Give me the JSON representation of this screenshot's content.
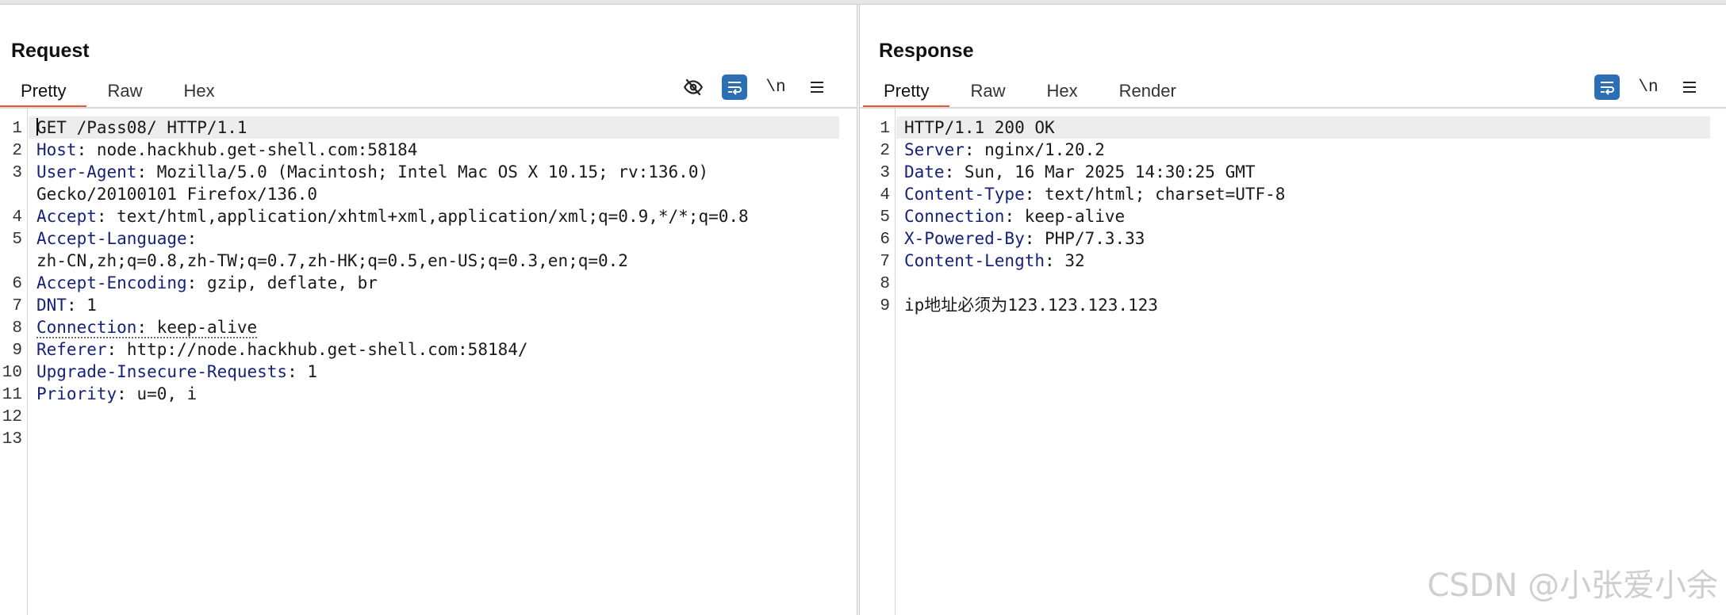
{
  "layout_switch": {
    "options": [
      "side-by-side",
      "stacked",
      "single"
    ]
  },
  "request": {
    "title": "Request",
    "tabs": [
      "Pretty",
      "Raw",
      "Hex"
    ],
    "active_tab": "Pretty",
    "tools": {
      "hide_icon": "eye-slash-icon",
      "wrap_icon": "wrap-text-icon",
      "newline_label": "\\n",
      "menu_icon": "menu-icon"
    },
    "line_numbers": [
      "1",
      "2",
      "3",
      "4",
      "5",
      "6",
      "7",
      "8",
      "9",
      "10",
      "11",
      "12",
      "13"
    ],
    "lines": [
      {
        "name": "",
        "sep": "",
        "value": "GET /Pass08/ HTTP/1.1"
      },
      {
        "name": "Host",
        "sep": ": ",
        "value": "node.hackhub.get-shell.com:58184"
      },
      {
        "name": "User-Agent",
        "sep": ": ",
        "value": "Mozilla/5.0 (Macintosh; Intel Mac OS X 10.15; rv:136.0)"
      },
      {
        "name": "",
        "sep": "",
        "value": "Gecko/20100101 Firefox/136.0"
      },
      {
        "name": "Accept",
        "sep": ": ",
        "value": "text/html,application/xhtml+xml,application/xml;q=0.9,*/*;q=0.8"
      },
      {
        "name": "Accept-Language",
        "sep": ":",
        "value": ""
      },
      {
        "name": "",
        "sep": "",
        "value": "zh-CN,zh;q=0.8,zh-TW;q=0.7,zh-HK;q=0.5,en-US;q=0.3,en;q=0.2"
      },
      {
        "name": "Accept-Encoding",
        "sep": ": ",
        "value": "gzip, deflate, br"
      },
      {
        "name": "DNT",
        "sep": ": ",
        "value": "1"
      },
      {
        "name": "Connection",
        "sep": ": ",
        "value": "keep-alive"
      },
      {
        "name": "Referer",
        "sep": ": ",
        "value": "http://node.hackhub.get-shell.com:58184/"
      },
      {
        "name": "Upgrade-Insecure-Requests",
        "sep": ": ",
        "value": "1"
      },
      {
        "name": "Priority",
        "sep": ": ",
        "value": "u=0, i"
      }
    ]
  },
  "response": {
    "title": "Response",
    "tabs": [
      "Pretty",
      "Raw",
      "Hex",
      "Render"
    ],
    "active_tab": "Pretty",
    "tools": {
      "wrap_icon": "wrap-text-icon",
      "newline_label": "\\n",
      "menu_icon": "menu-icon"
    },
    "line_numbers": [
      "1",
      "2",
      "3",
      "4",
      "5",
      "6",
      "7",
      "8",
      "9"
    ],
    "lines": [
      {
        "name": "",
        "sep": "",
        "value": "HTTP/1.1 200 OK"
      },
      {
        "name": "Server",
        "sep": ": ",
        "value": "nginx/1.20.2"
      },
      {
        "name": "Date",
        "sep": ": ",
        "value": "Sun, 16 Mar 2025 14:30:25 GMT"
      },
      {
        "name": "Content-Type",
        "sep": ": ",
        "value": "text/html; charset=UTF-8"
      },
      {
        "name": "Connection",
        "sep": ": ",
        "value": "keep-alive"
      },
      {
        "name": "X-Powered-By",
        "sep": ": ",
        "value": "PHP/7.3.33"
      },
      {
        "name": "Content-Length",
        "sep": ": ",
        "value": "32"
      },
      {
        "name": "",
        "sep": "",
        "value": ""
      },
      {
        "name": "",
        "sep": "",
        "value": "ip地址必须为123.123.123.123"
      }
    ]
  },
  "watermark": "CSDN @小张爱小余",
  "colors": {
    "accent_tab": "#e8572d",
    "button_blue": "#2d6fb4",
    "header_name": "#16227a"
  }
}
